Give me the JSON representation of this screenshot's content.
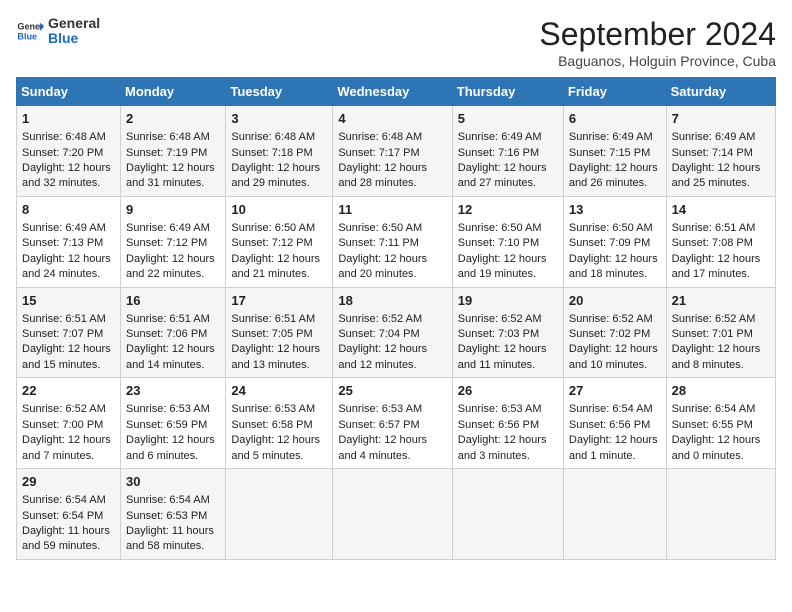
{
  "logo": {
    "line1": "General",
    "line2": "Blue"
  },
  "title": "September 2024",
  "subtitle": "Baguanos, Holguin Province, Cuba",
  "headers": [
    "Sunday",
    "Monday",
    "Tuesday",
    "Wednesday",
    "Thursday",
    "Friday",
    "Saturday"
  ],
  "weeks": [
    [
      {
        "day": "1",
        "sunrise": "Sunrise: 6:48 AM",
        "sunset": "Sunset: 7:20 PM",
        "daylight": "Daylight: 12 hours and 32 minutes."
      },
      {
        "day": "2",
        "sunrise": "Sunrise: 6:48 AM",
        "sunset": "Sunset: 7:19 PM",
        "daylight": "Daylight: 12 hours and 31 minutes."
      },
      {
        "day": "3",
        "sunrise": "Sunrise: 6:48 AM",
        "sunset": "Sunset: 7:18 PM",
        "daylight": "Daylight: 12 hours and 29 minutes."
      },
      {
        "day": "4",
        "sunrise": "Sunrise: 6:48 AM",
        "sunset": "Sunset: 7:17 PM",
        "daylight": "Daylight: 12 hours and 28 minutes."
      },
      {
        "day": "5",
        "sunrise": "Sunrise: 6:49 AM",
        "sunset": "Sunset: 7:16 PM",
        "daylight": "Daylight: 12 hours and 27 minutes."
      },
      {
        "day": "6",
        "sunrise": "Sunrise: 6:49 AM",
        "sunset": "Sunset: 7:15 PM",
        "daylight": "Daylight: 12 hours and 26 minutes."
      },
      {
        "day": "7",
        "sunrise": "Sunrise: 6:49 AM",
        "sunset": "Sunset: 7:14 PM",
        "daylight": "Daylight: 12 hours and 25 minutes."
      }
    ],
    [
      {
        "day": "8",
        "sunrise": "Sunrise: 6:49 AM",
        "sunset": "Sunset: 7:13 PM",
        "daylight": "Daylight: 12 hours and 24 minutes."
      },
      {
        "day": "9",
        "sunrise": "Sunrise: 6:49 AM",
        "sunset": "Sunset: 7:12 PM",
        "daylight": "Daylight: 12 hours and 22 minutes."
      },
      {
        "day": "10",
        "sunrise": "Sunrise: 6:50 AM",
        "sunset": "Sunset: 7:12 PM",
        "daylight": "Daylight: 12 hours and 21 minutes."
      },
      {
        "day": "11",
        "sunrise": "Sunrise: 6:50 AM",
        "sunset": "Sunset: 7:11 PM",
        "daylight": "Daylight: 12 hours and 20 minutes."
      },
      {
        "day": "12",
        "sunrise": "Sunrise: 6:50 AM",
        "sunset": "Sunset: 7:10 PM",
        "daylight": "Daylight: 12 hours and 19 minutes."
      },
      {
        "day": "13",
        "sunrise": "Sunrise: 6:50 AM",
        "sunset": "Sunset: 7:09 PM",
        "daylight": "Daylight: 12 hours and 18 minutes."
      },
      {
        "day": "14",
        "sunrise": "Sunrise: 6:51 AM",
        "sunset": "Sunset: 7:08 PM",
        "daylight": "Daylight: 12 hours and 17 minutes."
      }
    ],
    [
      {
        "day": "15",
        "sunrise": "Sunrise: 6:51 AM",
        "sunset": "Sunset: 7:07 PM",
        "daylight": "Daylight: 12 hours and 15 minutes."
      },
      {
        "day": "16",
        "sunrise": "Sunrise: 6:51 AM",
        "sunset": "Sunset: 7:06 PM",
        "daylight": "Daylight: 12 hours and 14 minutes."
      },
      {
        "day": "17",
        "sunrise": "Sunrise: 6:51 AM",
        "sunset": "Sunset: 7:05 PM",
        "daylight": "Daylight: 12 hours and 13 minutes."
      },
      {
        "day": "18",
        "sunrise": "Sunrise: 6:52 AM",
        "sunset": "Sunset: 7:04 PM",
        "daylight": "Daylight: 12 hours and 12 minutes."
      },
      {
        "day": "19",
        "sunrise": "Sunrise: 6:52 AM",
        "sunset": "Sunset: 7:03 PM",
        "daylight": "Daylight: 12 hours and 11 minutes."
      },
      {
        "day": "20",
        "sunrise": "Sunrise: 6:52 AM",
        "sunset": "Sunset: 7:02 PM",
        "daylight": "Daylight: 12 hours and 10 minutes."
      },
      {
        "day": "21",
        "sunrise": "Sunrise: 6:52 AM",
        "sunset": "Sunset: 7:01 PM",
        "daylight": "Daylight: 12 hours and 8 minutes."
      }
    ],
    [
      {
        "day": "22",
        "sunrise": "Sunrise: 6:52 AM",
        "sunset": "Sunset: 7:00 PM",
        "daylight": "Daylight: 12 hours and 7 minutes."
      },
      {
        "day": "23",
        "sunrise": "Sunrise: 6:53 AM",
        "sunset": "Sunset: 6:59 PM",
        "daylight": "Daylight: 12 hours and 6 minutes."
      },
      {
        "day": "24",
        "sunrise": "Sunrise: 6:53 AM",
        "sunset": "Sunset: 6:58 PM",
        "daylight": "Daylight: 12 hours and 5 minutes."
      },
      {
        "day": "25",
        "sunrise": "Sunrise: 6:53 AM",
        "sunset": "Sunset: 6:57 PM",
        "daylight": "Daylight: 12 hours and 4 minutes."
      },
      {
        "day": "26",
        "sunrise": "Sunrise: 6:53 AM",
        "sunset": "Sunset: 6:56 PM",
        "daylight": "Daylight: 12 hours and 3 minutes."
      },
      {
        "day": "27",
        "sunrise": "Sunrise: 6:54 AM",
        "sunset": "Sunset: 6:56 PM",
        "daylight": "Daylight: 12 hours and 1 minute."
      },
      {
        "day": "28",
        "sunrise": "Sunrise: 6:54 AM",
        "sunset": "Sunset: 6:55 PM",
        "daylight": "Daylight: 12 hours and 0 minutes."
      }
    ],
    [
      {
        "day": "29",
        "sunrise": "Sunrise: 6:54 AM",
        "sunset": "Sunset: 6:54 PM",
        "daylight": "Daylight: 11 hours and 59 minutes."
      },
      {
        "day": "30",
        "sunrise": "Sunrise: 6:54 AM",
        "sunset": "Sunset: 6:53 PM",
        "daylight": "Daylight: 11 hours and 58 minutes."
      },
      null,
      null,
      null,
      null,
      null
    ]
  ]
}
